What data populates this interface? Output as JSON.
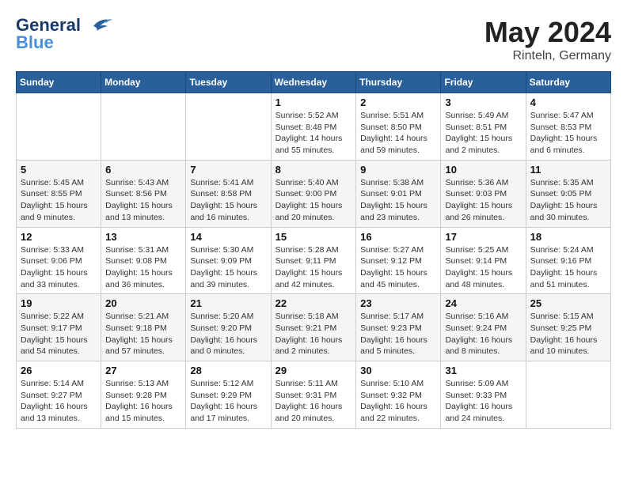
{
  "header": {
    "logo_line1": "General",
    "logo_line2": "Blue",
    "month": "May 2024",
    "location": "Rinteln, Germany"
  },
  "days_of_week": [
    "Sunday",
    "Monday",
    "Tuesday",
    "Wednesday",
    "Thursday",
    "Friday",
    "Saturday"
  ],
  "weeks": [
    [
      {
        "day": "",
        "info": ""
      },
      {
        "day": "",
        "info": ""
      },
      {
        "day": "",
        "info": ""
      },
      {
        "day": "1",
        "info": "Sunrise: 5:52 AM\nSunset: 8:48 PM\nDaylight: 14 hours\nand 55 minutes."
      },
      {
        "day": "2",
        "info": "Sunrise: 5:51 AM\nSunset: 8:50 PM\nDaylight: 14 hours\nand 59 minutes."
      },
      {
        "day": "3",
        "info": "Sunrise: 5:49 AM\nSunset: 8:51 PM\nDaylight: 15 hours\nand 2 minutes."
      },
      {
        "day": "4",
        "info": "Sunrise: 5:47 AM\nSunset: 8:53 PM\nDaylight: 15 hours\nand 6 minutes."
      }
    ],
    [
      {
        "day": "5",
        "info": "Sunrise: 5:45 AM\nSunset: 8:55 PM\nDaylight: 15 hours\nand 9 minutes."
      },
      {
        "day": "6",
        "info": "Sunrise: 5:43 AM\nSunset: 8:56 PM\nDaylight: 15 hours\nand 13 minutes."
      },
      {
        "day": "7",
        "info": "Sunrise: 5:41 AM\nSunset: 8:58 PM\nDaylight: 15 hours\nand 16 minutes."
      },
      {
        "day": "8",
        "info": "Sunrise: 5:40 AM\nSunset: 9:00 PM\nDaylight: 15 hours\nand 20 minutes."
      },
      {
        "day": "9",
        "info": "Sunrise: 5:38 AM\nSunset: 9:01 PM\nDaylight: 15 hours\nand 23 minutes."
      },
      {
        "day": "10",
        "info": "Sunrise: 5:36 AM\nSunset: 9:03 PM\nDaylight: 15 hours\nand 26 minutes."
      },
      {
        "day": "11",
        "info": "Sunrise: 5:35 AM\nSunset: 9:05 PM\nDaylight: 15 hours\nand 30 minutes."
      }
    ],
    [
      {
        "day": "12",
        "info": "Sunrise: 5:33 AM\nSunset: 9:06 PM\nDaylight: 15 hours\nand 33 minutes."
      },
      {
        "day": "13",
        "info": "Sunrise: 5:31 AM\nSunset: 9:08 PM\nDaylight: 15 hours\nand 36 minutes."
      },
      {
        "day": "14",
        "info": "Sunrise: 5:30 AM\nSunset: 9:09 PM\nDaylight: 15 hours\nand 39 minutes."
      },
      {
        "day": "15",
        "info": "Sunrise: 5:28 AM\nSunset: 9:11 PM\nDaylight: 15 hours\nand 42 minutes."
      },
      {
        "day": "16",
        "info": "Sunrise: 5:27 AM\nSunset: 9:12 PM\nDaylight: 15 hours\nand 45 minutes."
      },
      {
        "day": "17",
        "info": "Sunrise: 5:25 AM\nSunset: 9:14 PM\nDaylight: 15 hours\nand 48 minutes."
      },
      {
        "day": "18",
        "info": "Sunrise: 5:24 AM\nSunset: 9:16 PM\nDaylight: 15 hours\nand 51 minutes."
      }
    ],
    [
      {
        "day": "19",
        "info": "Sunrise: 5:22 AM\nSunset: 9:17 PM\nDaylight: 15 hours\nand 54 minutes."
      },
      {
        "day": "20",
        "info": "Sunrise: 5:21 AM\nSunset: 9:18 PM\nDaylight: 15 hours\nand 57 minutes."
      },
      {
        "day": "21",
        "info": "Sunrise: 5:20 AM\nSunset: 9:20 PM\nDaylight: 16 hours\nand 0 minutes."
      },
      {
        "day": "22",
        "info": "Sunrise: 5:18 AM\nSunset: 9:21 PM\nDaylight: 16 hours\nand 2 minutes."
      },
      {
        "day": "23",
        "info": "Sunrise: 5:17 AM\nSunset: 9:23 PM\nDaylight: 16 hours\nand 5 minutes."
      },
      {
        "day": "24",
        "info": "Sunrise: 5:16 AM\nSunset: 9:24 PM\nDaylight: 16 hours\nand 8 minutes."
      },
      {
        "day": "25",
        "info": "Sunrise: 5:15 AM\nSunset: 9:25 PM\nDaylight: 16 hours\nand 10 minutes."
      }
    ],
    [
      {
        "day": "26",
        "info": "Sunrise: 5:14 AM\nSunset: 9:27 PM\nDaylight: 16 hours\nand 13 minutes."
      },
      {
        "day": "27",
        "info": "Sunrise: 5:13 AM\nSunset: 9:28 PM\nDaylight: 16 hours\nand 15 minutes."
      },
      {
        "day": "28",
        "info": "Sunrise: 5:12 AM\nSunset: 9:29 PM\nDaylight: 16 hours\nand 17 minutes."
      },
      {
        "day": "29",
        "info": "Sunrise: 5:11 AM\nSunset: 9:31 PM\nDaylight: 16 hours\nand 20 minutes."
      },
      {
        "day": "30",
        "info": "Sunrise: 5:10 AM\nSunset: 9:32 PM\nDaylight: 16 hours\nand 22 minutes."
      },
      {
        "day": "31",
        "info": "Sunrise: 5:09 AM\nSunset: 9:33 PM\nDaylight: 16 hours\nand 24 minutes."
      },
      {
        "day": "",
        "info": ""
      }
    ]
  ]
}
